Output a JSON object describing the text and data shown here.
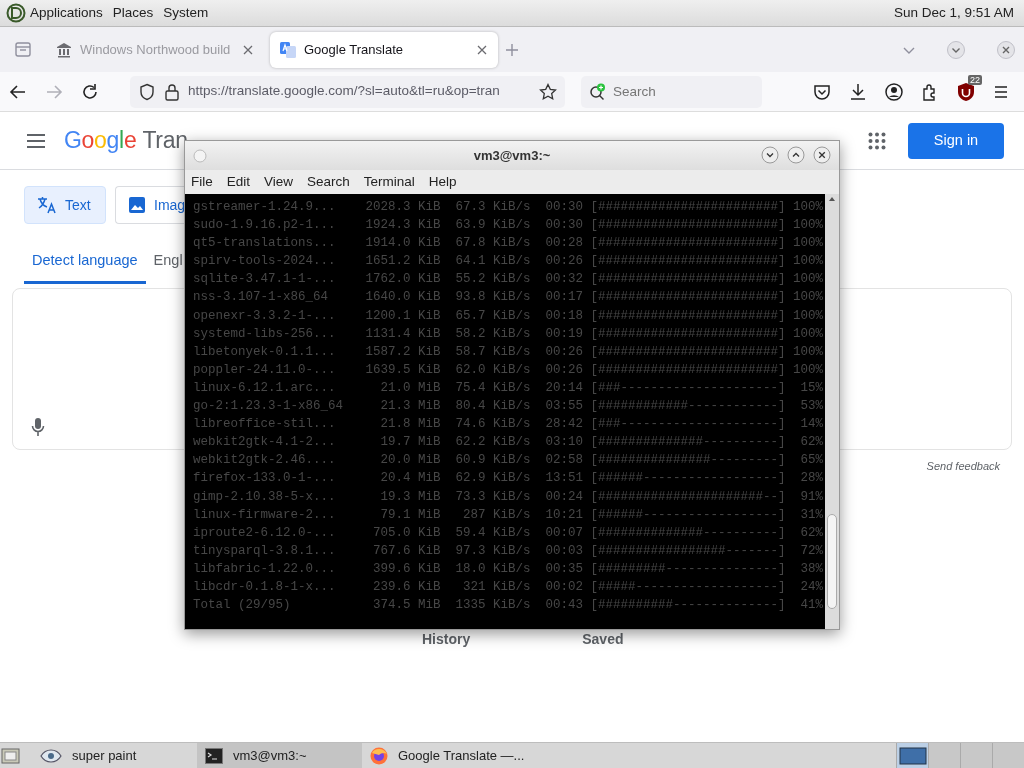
{
  "top_panel": {
    "menus": [
      "Applications",
      "Places",
      "System"
    ],
    "clock": "Sun Dec 1, 9:51 AM"
  },
  "browser": {
    "tabs": [
      {
        "title": "Windows Northwood build",
        "selected": false
      },
      {
        "title": "Google Translate",
        "selected": true
      }
    ],
    "url": "https://translate.google.com/?sl=auto&tl=ru&op=tran",
    "search": {
      "placeholder": "Search"
    },
    "extension_badge": "22"
  },
  "page": {
    "logo": [
      "Google",
      "Tran"
    ],
    "sign_in": "Sign in",
    "mode_buttons": [
      {
        "label": "Text",
        "selected": true
      },
      {
        "label": "Imag",
        "selected": false
      }
    ],
    "language_tabs": [
      {
        "label": "Detect language",
        "selected": true
      },
      {
        "label": "Engl",
        "selected": false
      }
    ],
    "send_feedback": "Send feedback",
    "bottom_links": [
      "History",
      "Saved"
    ]
  },
  "terminal": {
    "title": "vm3@vm3:~",
    "menu": [
      "File",
      "Edit",
      "View",
      "Search",
      "Terminal",
      "Help"
    ],
    "lines": [
      {
        "name": "gstreamer-1.24.9...",
        "size": "2028.3 KiB",
        "speed": "67.3 KiB/s",
        "time": "00:30",
        "bar": "[########################]",
        "percent": "100%"
      },
      {
        "name": "sudo-1.9.16.p2-1...",
        "size": "1924.3 KiB",
        "speed": "63.9 KiB/s",
        "time": "00:30",
        "bar": "[########################]",
        "percent": "100%"
      },
      {
        "name": "qt5-translations...",
        "size": "1914.0 KiB",
        "speed": "67.8 KiB/s",
        "time": "00:28",
        "bar": "[########################]",
        "percent": "100%"
      },
      {
        "name": "spirv-tools-2024...",
        "size": "1651.2 KiB",
        "speed": "64.1 KiB/s",
        "time": "00:26",
        "bar": "[########################]",
        "percent": "100%"
      },
      {
        "name": "sqlite-3.47.1-1-...",
        "size": "1762.0 KiB",
        "speed": "55.2 KiB/s",
        "time": "00:32",
        "bar": "[########################]",
        "percent": "100%"
      },
      {
        "name": "nss-3.107-1-x86_64",
        "size": "1640.0 KiB",
        "speed": "93.8 KiB/s",
        "time": "00:17",
        "bar": "[########################]",
        "percent": "100%"
      },
      {
        "name": "openexr-3.3.2-1-...",
        "size": "1200.1 KiB",
        "speed": "65.7 KiB/s",
        "time": "00:18",
        "bar": "[########################]",
        "percent": "100%"
      },
      {
        "name": "systemd-libs-256...",
        "size": "1131.4 KiB",
        "speed": "58.2 KiB/s",
        "time": "00:19",
        "bar": "[########################]",
        "percent": "100%"
      },
      {
        "name": "libetonyek-0.1.1...",
        "size": "1587.2 KiB",
        "speed": "58.7 KiB/s",
        "time": "00:26",
        "bar": "[########################]",
        "percent": "100%"
      },
      {
        "name": "poppler-24.11.0-...",
        "size": "1639.5 KiB",
        "speed": "62.0 KiB/s",
        "time": "00:26",
        "bar": "[########################]",
        "percent": "100%"
      },
      {
        "name": "linux-6.12.1.arc...",
        "size": "21.0 MiB",
        "speed": "75.4 KiB/s",
        "time": "20:14",
        "bar": "[###---------------------]",
        "percent": "15%"
      },
      {
        "name": "go-2:1.23.3-1-x86_64",
        "size": "21.3 MiB",
        "speed": "80.4 KiB/s",
        "time": "03:55",
        "bar": "[############------------]",
        "percent": "53%"
      },
      {
        "name": "libreoffice-stil...",
        "size": "21.8 MiB",
        "speed": "74.6 KiB/s",
        "time": "28:42",
        "bar": "[###---------------------]",
        "percent": "14%"
      },
      {
        "name": "webkit2gtk-4.1-2...",
        "size": "19.7 MiB",
        "speed": "62.2 KiB/s",
        "time": "03:10",
        "bar": "[##############----------]",
        "percent": "62%"
      },
      {
        "name": "webkit2gtk-2.46....",
        "size": "20.0 MiB",
        "speed": "60.9 KiB/s",
        "time": "02:58",
        "bar": "[###############---------]",
        "percent": "65%"
      },
      {
        "name": "firefox-133.0-1-...",
        "size": "20.4 MiB",
        "speed": "62.9 KiB/s",
        "time": "13:51",
        "bar": "[######------------------]",
        "percent": "28%"
      },
      {
        "name": "gimp-2.10.38-5-x...",
        "size": "19.3 MiB",
        "speed": "73.3 KiB/s",
        "time": "00:24",
        "bar": "[######################--]",
        "percent": "91%"
      },
      {
        "name": "linux-firmware-2...",
        "size": "79.1 MiB",
        "speed": "287 KiB/s",
        "time": "10:21",
        "bar": "[######------------------]",
        "percent": "31%"
      },
      {
        "name": "iproute2-6.12.0-...",
        "size": "705.0 KiB",
        "speed": "59.4 KiB/s",
        "time": "00:07",
        "bar": "[##############----------]",
        "percent": "62%"
      },
      {
        "name": "tinysparql-3.8.1...",
        "size": "767.6 KiB",
        "speed": "97.3 KiB/s",
        "time": "00:03",
        "bar": "[#################-------]",
        "percent": "72%"
      },
      {
        "name": "libfabric-1.22.0...",
        "size": "399.6 KiB",
        "speed": "18.0 KiB/s",
        "time": "00:35",
        "bar": "[#########---------------]",
        "percent": "38%"
      },
      {
        "name": "libcdr-0.1.8-1-x...",
        "size": "239.6 KiB",
        "speed": "321 KiB/s",
        "time": "00:02",
        "bar": "[#####-------------------]",
        "percent": "24%"
      },
      {
        "name": "Total (29/95)",
        "size": "374.5 MiB",
        "speed": "1335 KiB/s",
        "time": "00:43",
        "bar": "[##########--------------]",
        "percent": "41%"
      }
    ]
  },
  "taskbar": {
    "items": [
      {
        "label": "super paint",
        "kind": "paint",
        "selected": false
      },
      {
        "label": "vm3@vm3:~",
        "kind": "terminal",
        "selected": true
      },
      {
        "label": "Google Translate —...",
        "kind": "browser",
        "selected": false
      }
    ],
    "workspaces": [
      {
        "selected": true
      },
      {
        "selected": false
      },
      {
        "selected": false
      },
      {
        "selected": false
      }
    ]
  }
}
